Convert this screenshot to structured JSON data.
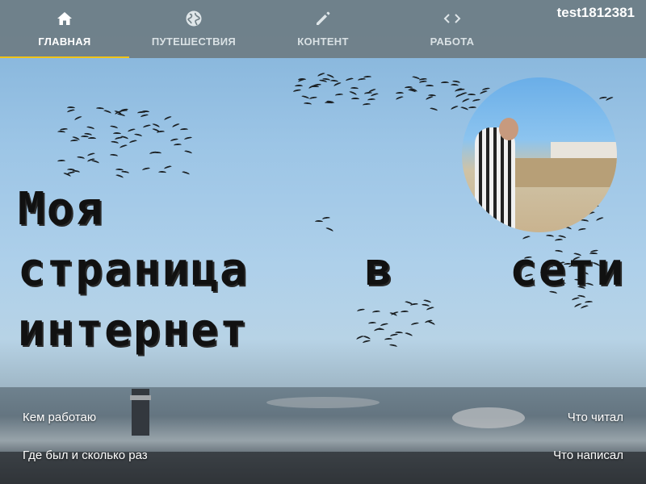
{
  "nav": {
    "tabs": [
      {
        "label": "Главная",
        "icon": "home-icon",
        "active": true
      },
      {
        "label": "Путешествия",
        "icon": "globe-icon",
        "active": false
      },
      {
        "label": "Контент",
        "icon": "pencil-icon",
        "active": false
      },
      {
        "label": "Работа",
        "icon": "code-icon",
        "active": false
      }
    ],
    "username": "test1812381",
    "active_color": "#f0c419"
  },
  "hero": {
    "headline_lines": [
      "Моя",
      "страница",
      "в",
      "сети",
      "интернет"
    ]
  },
  "bottom_links": {
    "work": "Кем работаю",
    "travel": "Где был и сколько раз",
    "read": "Что читал",
    "wrote": "Что написал"
  }
}
